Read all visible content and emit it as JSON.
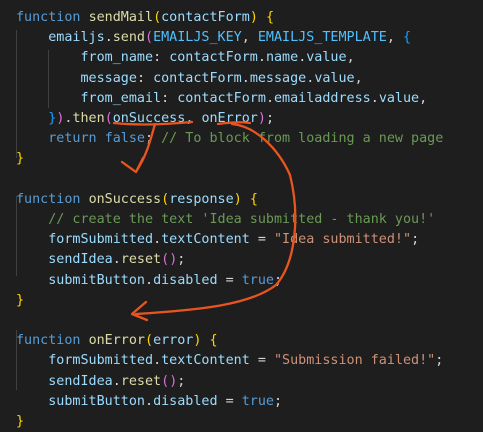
{
  "editor": {
    "lines": [
      [
        {
          "t": "function",
          "c": "kw"
        },
        {
          "t": " ",
          "c": ""
        },
        {
          "t": "sendMail",
          "c": "fn"
        },
        {
          "t": "(",
          "c": "b1"
        },
        {
          "t": "contactForm",
          "c": "var"
        },
        {
          "t": ")",
          "c": "b1"
        },
        {
          "t": " ",
          "c": ""
        },
        {
          "t": "{",
          "c": "b1"
        }
      ],
      [
        {
          "t": "    ",
          "c": ""
        },
        {
          "t": "emailjs",
          "c": "var"
        },
        {
          "t": ".",
          "c": ""
        },
        {
          "t": "send",
          "c": "fn"
        },
        {
          "t": "(",
          "c": "b2"
        },
        {
          "t": "EMAILJS_KEY",
          "c": "const"
        },
        {
          "t": ", ",
          "c": ""
        },
        {
          "t": "EMAILJS_TEMPLATE",
          "c": "const"
        },
        {
          "t": ", ",
          "c": ""
        },
        {
          "t": "{",
          "c": "b3"
        }
      ],
      [
        {
          "t": "        ",
          "c": ""
        },
        {
          "t": "from_name",
          "c": "var"
        },
        {
          "t": ": ",
          "c": ""
        },
        {
          "t": "contactForm",
          "c": "var"
        },
        {
          "t": ".",
          "c": ""
        },
        {
          "t": "name",
          "c": "var"
        },
        {
          "t": ".",
          "c": ""
        },
        {
          "t": "value",
          "c": "var"
        },
        {
          "t": ",",
          "c": ""
        }
      ],
      [
        {
          "t": "        ",
          "c": ""
        },
        {
          "t": "message",
          "c": "var"
        },
        {
          "t": ": ",
          "c": ""
        },
        {
          "t": "contactForm",
          "c": "var"
        },
        {
          "t": ".",
          "c": ""
        },
        {
          "t": "message",
          "c": "var"
        },
        {
          "t": ".",
          "c": ""
        },
        {
          "t": "value",
          "c": "var"
        },
        {
          "t": ",",
          "c": ""
        }
      ],
      [
        {
          "t": "        ",
          "c": ""
        },
        {
          "t": "from_email",
          "c": "var"
        },
        {
          "t": ": ",
          "c": ""
        },
        {
          "t": "contactForm",
          "c": "var"
        },
        {
          "t": ".",
          "c": ""
        },
        {
          "t": "emailaddress",
          "c": "var"
        },
        {
          "t": ".",
          "c": ""
        },
        {
          "t": "value",
          "c": "var"
        },
        {
          "t": ",",
          "c": ""
        }
      ],
      [
        {
          "t": "    ",
          "c": ""
        },
        {
          "t": "}",
          "c": "b3"
        },
        {
          "t": ")",
          "c": "b2"
        },
        {
          "t": ".",
          "c": ""
        },
        {
          "t": "then",
          "c": "fn"
        },
        {
          "t": "(",
          "c": "b2"
        },
        {
          "t": "onSuccess",
          "c": "var"
        },
        {
          "t": ", ",
          "c": ""
        },
        {
          "t": "onError",
          "c": "var"
        },
        {
          "t": ")",
          "c": "b2"
        },
        {
          "t": ";",
          "c": ""
        }
      ],
      [
        {
          "t": "    ",
          "c": ""
        },
        {
          "t": "return",
          "c": "kw"
        },
        {
          "t": " ",
          "c": ""
        },
        {
          "t": "false",
          "c": "kw"
        },
        {
          "t": "; ",
          "c": ""
        },
        {
          "t": "// To block from loading a new page",
          "c": "cmt"
        }
      ],
      [
        {
          "t": "}",
          "c": "b1"
        }
      ],
      [],
      [
        {
          "t": "function",
          "c": "kw"
        },
        {
          "t": " ",
          "c": ""
        },
        {
          "t": "onSuccess",
          "c": "fn"
        },
        {
          "t": "(",
          "c": "b1"
        },
        {
          "t": "response",
          "c": "var"
        },
        {
          "t": ")",
          "c": "b1"
        },
        {
          "t": " ",
          "c": ""
        },
        {
          "t": "{",
          "c": "b1"
        }
      ],
      [
        {
          "t": "    ",
          "c": ""
        },
        {
          "t": "// create the text 'Idea submitted - thank you!'",
          "c": "cmt"
        }
      ],
      [
        {
          "t": "    ",
          "c": ""
        },
        {
          "t": "formSubmitted",
          "c": "var"
        },
        {
          "t": ".",
          "c": ""
        },
        {
          "t": "textContent",
          "c": "var"
        },
        {
          "t": " = ",
          "c": ""
        },
        {
          "t": "\"Idea submitted!\"",
          "c": "str"
        },
        {
          "t": ";",
          "c": ""
        }
      ],
      [
        {
          "t": "    ",
          "c": ""
        },
        {
          "t": "sendIdea",
          "c": "var"
        },
        {
          "t": ".",
          "c": ""
        },
        {
          "t": "reset",
          "c": "fn"
        },
        {
          "t": "(",
          "c": "b2"
        },
        {
          "t": ")",
          "c": "b2"
        },
        {
          "t": ";",
          "c": ""
        }
      ],
      [
        {
          "t": "    ",
          "c": ""
        },
        {
          "t": "submitButton",
          "c": "var"
        },
        {
          "t": ".",
          "c": ""
        },
        {
          "t": "disabled",
          "c": "var"
        },
        {
          "t": " = ",
          "c": ""
        },
        {
          "t": "true",
          "c": "kw"
        },
        {
          "t": ";",
          "c": ""
        }
      ],
      [
        {
          "t": "}",
          "c": "b1"
        }
      ],
      [],
      [
        {
          "t": "function",
          "c": "kw"
        },
        {
          "t": " ",
          "c": ""
        },
        {
          "t": "onError",
          "c": "fn"
        },
        {
          "t": "(",
          "c": "b1"
        },
        {
          "t": "error",
          "c": "var"
        },
        {
          "t": ")",
          "c": "b1"
        },
        {
          "t": " ",
          "c": ""
        },
        {
          "t": "{",
          "c": "b1"
        }
      ],
      [
        {
          "t": "    ",
          "c": ""
        },
        {
          "t": "formSubmitted",
          "c": "var"
        },
        {
          "t": ".",
          "c": ""
        },
        {
          "t": "textContent",
          "c": "var"
        },
        {
          "t": " = ",
          "c": ""
        },
        {
          "t": "\"Submission failed!\"",
          "c": "str"
        },
        {
          "t": ";",
          "c": ""
        }
      ],
      [
        {
          "t": "    ",
          "c": ""
        },
        {
          "t": "sendIdea",
          "c": "var"
        },
        {
          "t": ".",
          "c": ""
        },
        {
          "t": "reset",
          "c": "fn"
        },
        {
          "t": "(",
          "c": "b2"
        },
        {
          "t": ")",
          "c": "b2"
        },
        {
          "t": ";",
          "c": ""
        }
      ],
      [
        {
          "t": "    ",
          "c": ""
        },
        {
          "t": "submitButton",
          "c": "var"
        },
        {
          "t": ".",
          "c": ""
        },
        {
          "t": "disabled",
          "c": "var"
        },
        {
          "t": " = ",
          "c": ""
        },
        {
          "t": "true",
          "c": "kw"
        },
        {
          "t": ";",
          "c": ""
        }
      ],
      [
        {
          "t": "}",
          "c": "b1"
        }
      ]
    ]
  },
  "annotation": {
    "color": "#e8551f",
    "shape": "hand-drawn arrows linking .then(onSuccess, onError) to the onSuccess and onError function definitions"
  }
}
